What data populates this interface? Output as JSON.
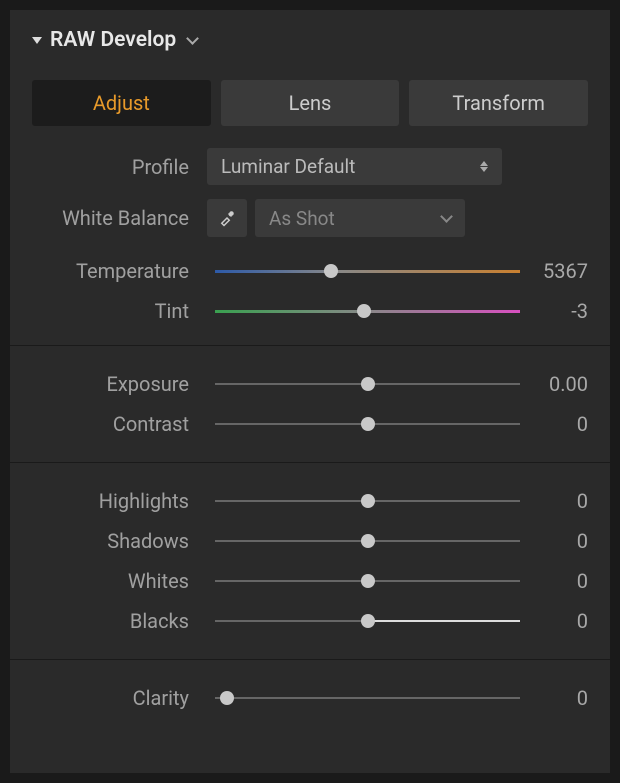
{
  "header": {
    "title": "RAW Develop"
  },
  "tabs": {
    "adjust": "Adjust",
    "lens": "Lens",
    "transform": "Transform"
  },
  "profile": {
    "label": "Profile",
    "value": "Luminar Default"
  },
  "whiteBalance": {
    "label": "White Balance",
    "value": "As Shot"
  },
  "sliders": {
    "temperature": {
      "label": "Temperature",
      "value": "5367",
      "pos": 38
    },
    "tint": {
      "label": "Tint",
      "value": "-3",
      "pos": 49
    },
    "exposure": {
      "label": "Exposure",
      "value": "0.00",
      "pos": 50
    },
    "contrast": {
      "label": "Contrast",
      "value": "0",
      "pos": 50
    },
    "highlights": {
      "label": "Highlights",
      "value": "0",
      "pos": 50
    },
    "shadows": {
      "label": "Shadows",
      "value": "0",
      "pos": 50
    },
    "whites": {
      "label": "Whites",
      "value": "0",
      "pos": 50
    },
    "blacks": {
      "label": "Blacks",
      "value": "0",
      "pos": 50
    },
    "clarity": {
      "label": "Clarity",
      "value": "0",
      "pos": 4
    }
  }
}
